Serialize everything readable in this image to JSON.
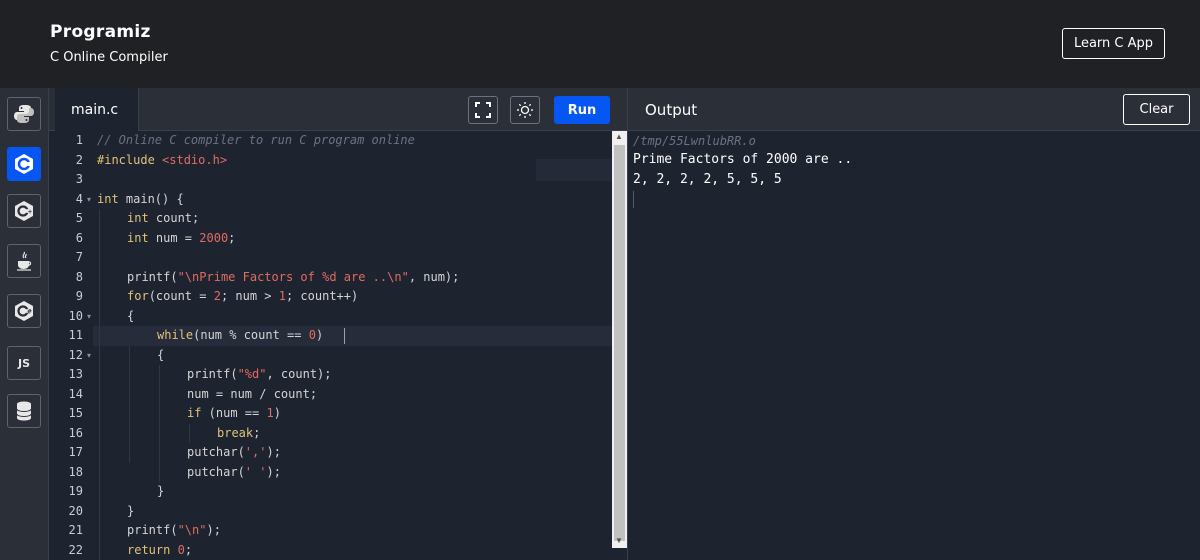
{
  "header": {
    "logo_text": "Programiz",
    "subtitle": "C Online Compiler",
    "learn_button": "Learn C App"
  },
  "sidebar": {
    "languages": [
      {
        "name": "python-icon"
      },
      {
        "name": "c-icon",
        "active": true
      },
      {
        "name": "cpp-icon"
      },
      {
        "name": "java-icon"
      },
      {
        "name": "csharp-icon"
      },
      {
        "name": "js-icon",
        "label": "JS"
      },
      {
        "name": "sql-icon"
      }
    ]
  },
  "editor": {
    "tab_label": "main.c",
    "run_label": "Run",
    "line_numbers": [
      "1",
      "2",
      "3",
      "4",
      "5",
      "6",
      "7",
      "8",
      "9",
      "10",
      "11",
      "12",
      "13",
      "14",
      "15",
      "16",
      "17",
      "18",
      "19",
      "20",
      "21",
      "22"
    ],
    "code": {
      "l1": "// Online C compiler to run C program online",
      "l2_pp": "#include ",
      "l2_hdr": "<stdio.h>",
      "l4_kw": "int",
      "l4_rest": " main() {",
      "l5_kw": "int",
      "l5_rest": " count;",
      "l6_kw": "int",
      "l6_rest": " num = ",
      "l6_num": "2000",
      "l6_end": ";",
      "l8_a": "printf(",
      "l8_str1": "\"",
      "l8_esc1": "\\n",
      "l8_str2": "Prime Factors of ",
      "l8_fmt": "%d",
      "l8_str3": " are ..",
      "l8_esc2": "\\n",
      "l8_str4": "\"",
      "l8_b": ", num);",
      "l9_kw": "for",
      "l9_a": "(count = ",
      "l9_n1": "2",
      "l9_b": "; num > ",
      "l9_n2": "1",
      "l9_c": "; count++)",
      "l10": "{",
      "l11_kw": "while",
      "l11_a": "(num % count == ",
      "l11_n": "0",
      "l11_b": ")",
      "l12": "{",
      "l13_a": "printf(",
      "l13_s": "\"%d\"",
      "l13_b": ", count);",
      "l14": "num = num / count;",
      "l15_kw": "if",
      "l15_a": " (num == ",
      "l15_n": "1",
      "l15_b": ")",
      "l16_kw": "break",
      "l16_b": ";",
      "l17_a": "putchar(",
      "l17_s": "','",
      "l17_b": ");",
      "l18_a": "putchar(",
      "l18_s": "' '",
      "l18_b": ");",
      "l19": "}",
      "l20": "}",
      "l21_a": "printf(",
      "l21_s": "\"\\n\"",
      "l21_b": ");",
      "l22_kw": "return",
      "l22_n": "0",
      "l22_b": ";"
    }
  },
  "output": {
    "title": "Output",
    "clear_label": "Clear",
    "lines": [
      "/tmp/55LwnlubRR.o",
      "Prime Factors of 2000 are ..",
      "2, 2, 2, 2, 5, 5, 5"
    ]
  },
  "colors": {
    "accent": "#0556f3",
    "background": "#1e2330",
    "topbar": "#202124"
  }
}
